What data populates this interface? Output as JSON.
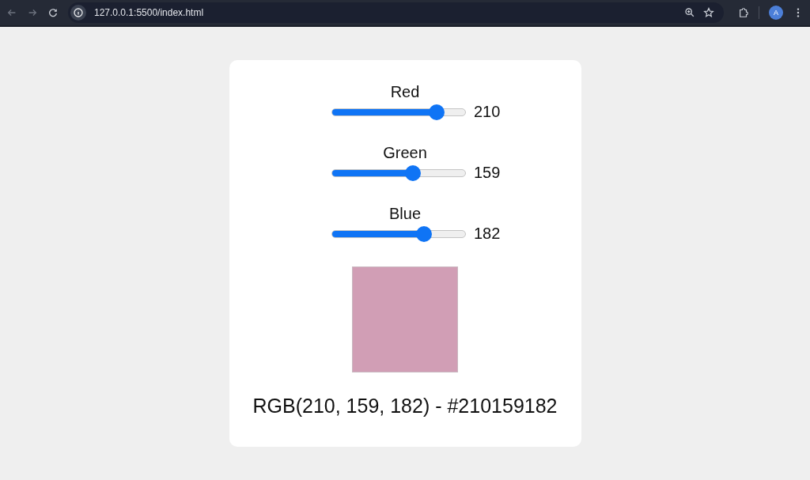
{
  "browser": {
    "url": "127.0.0.1:5500/index.html",
    "profile_initial": "A"
  },
  "sliders": [
    {
      "label": "Red",
      "level": 0.82,
      "reading": "210"
    },
    {
      "label": "Green",
      "level": 0.62,
      "reading": "159"
    },
    {
      "label": "Blue",
      "level": 0.71,
      "reading": "182"
    }
  ],
  "result": "RGB(210, 159, 182) - #210159182"
}
